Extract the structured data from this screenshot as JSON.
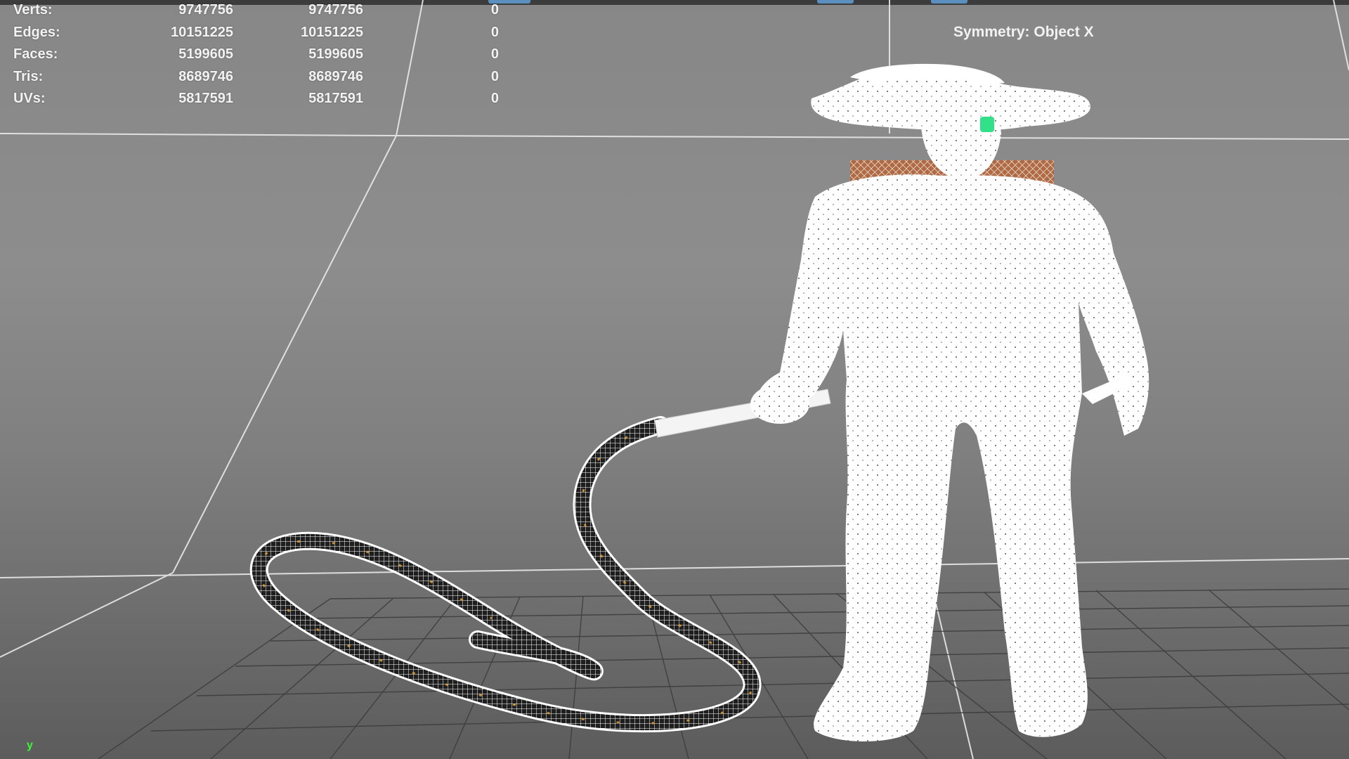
{
  "stats": [
    {
      "label": "Verts:",
      "v1": "9747756",
      "v2": "9747756",
      "v3": "0"
    },
    {
      "label": "Edges:",
      "v1": "10151225",
      "v2": "10151225",
      "v3": "0"
    },
    {
      "label": "Faces:",
      "v1": "5199605",
      "v2": "5199605",
      "v3": "0"
    },
    {
      "label": "Tris:",
      "v1": "8689746",
      "v2": "8689746",
      "v3": "0"
    },
    {
      "label": "UVs:",
      "v1": "5817591",
      "v2": "5817591",
      "v3": "0"
    }
  ],
  "symmetry": "Symmetry: Object X",
  "axis_label": "y",
  "colors": {
    "accent_tab": "#5b8fbf",
    "axis_green": "#3cf53c",
    "highlight_green": "#33e08a",
    "crate_brown": "#b06a43"
  }
}
